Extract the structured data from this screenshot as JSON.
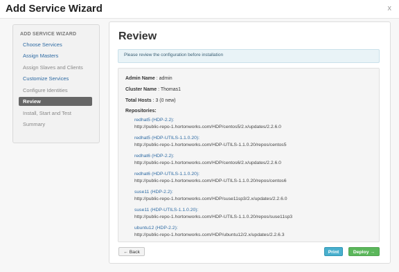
{
  "modal": {
    "title": "Add Service Wizard",
    "close_label": "x"
  },
  "sidebar": {
    "heading": "ADD SERVICE WIZARD",
    "items": [
      {
        "label": "Choose Services",
        "state": "done"
      },
      {
        "label": "Assign Masters",
        "state": "done"
      },
      {
        "label": "Assign Slaves and Clients",
        "state": "pending"
      },
      {
        "label": "Customize Services",
        "state": "done"
      },
      {
        "label": "Configure Identities",
        "state": "pending"
      },
      {
        "label": "Review",
        "state": "active"
      },
      {
        "label": "Install, Start and Test",
        "state": "pending"
      },
      {
        "label": "Summary",
        "state": "pending"
      }
    ]
  },
  "main": {
    "title": "Review",
    "alert": "Please review the configuration before installation",
    "admin_name_label": "Admin Name",
    "admin_name_value": " : admin",
    "cluster_name_label": "Cluster Name",
    "cluster_name_value": " : Thomas1",
    "total_hosts_label": "Total Hosts",
    "total_hosts_value": " : 3 (0 new)",
    "repositories_label": "Repositories:",
    "repositories": [
      {
        "os": "redhat5 (HDP-2.2):",
        "url": "http://public-repo-1.hortonworks.com/HDP/centos5/2.x/updates/2.2.6.0"
      },
      {
        "os": "redhat5 (HDP-UTILS-1.1.0.20):",
        "url": "http://public-repo-1.hortonworks.com/HDP-UTILS-1.1.0.20/repos/centos5"
      },
      {
        "os": "redhat6 (HDP-2.2):",
        "url": "http://public-repo-1.hortonworks.com/HDP/centos6/2.x/updates/2.2.6.0"
      },
      {
        "os": "redhat6 (HDP-UTILS-1.1.0.20):",
        "url": "http://public-repo-1.hortonworks.com/HDP-UTILS-1.1.0.20/repos/centos6"
      },
      {
        "os": "suse11 (HDP-2.2):",
        "url": "http://public-repo-1.hortonworks.com/HDP/suse11sp3/2.x/updates/2.2.6.0"
      },
      {
        "os": "suse11 (HDP-UTILS-1.1.0.20):",
        "url": "http://public-repo-1.hortonworks.com/HDP-UTILS-1.1.0.20/repos/suse11sp3"
      },
      {
        "os": "ubuntu12 (HDP-2.2):",
        "url": "http://public-repo-1.hortonworks.com/HDP/ubuntu12/2.x/updates/2.2.6.3"
      }
    ]
  },
  "footer": {
    "back_label": "← Back",
    "print_label": "Print",
    "deploy_label": "Deploy →"
  },
  "colors": {
    "link": "#2d6aa3",
    "active_nav": "#666666",
    "print_button": "#49afcd",
    "deploy_button": "#5bb75b",
    "alert_bg": "#e9f3f7"
  }
}
